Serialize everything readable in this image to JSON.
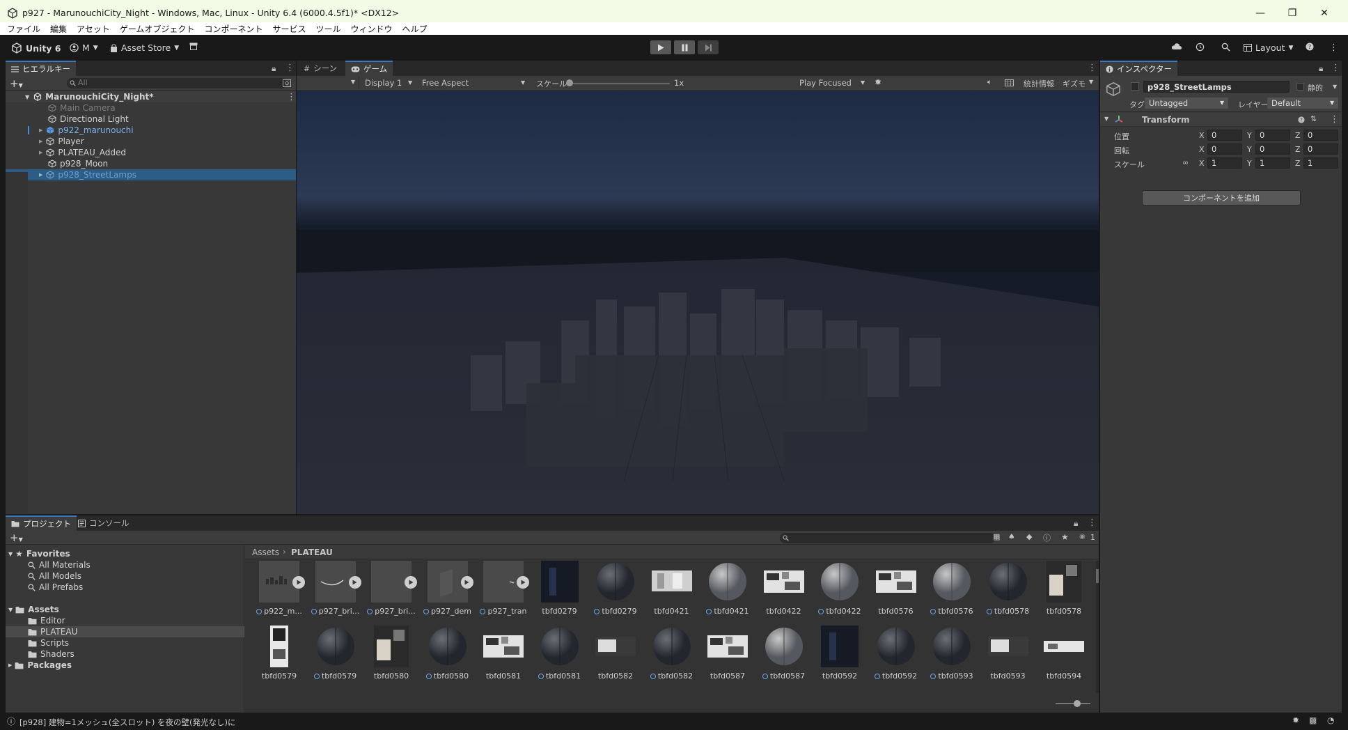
{
  "window": {
    "title": "p927 - MarunouchiCity_Night - Windows, Mac, Linux - Unity 6.4 (6000.4.5f1)* <DX12>"
  },
  "menu": [
    "ファイル",
    "編集",
    "アセット",
    "ゲームオブジェクト",
    "コンポーネント",
    "サービス",
    "ツール",
    "ウィンドウ",
    "ヘルプ"
  ],
  "toolbar": {
    "unity_label": "Unity 6",
    "account_label": "M",
    "asset_store_label": "Asset Store",
    "layout_label": "Layout"
  },
  "hierarchy": {
    "tab_label": "ヒエラルキー",
    "search_placeholder": "All",
    "scene_name": "MarunouchiCity_Night*",
    "items": [
      {
        "label": "Main Camera",
        "state": "disabled"
      },
      {
        "label": "Directional Light",
        "state": "normal"
      },
      {
        "label": "p922_marunouchi",
        "state": "prefab"
      },
      {
        "label": "Player",
        "state": "normal"
      },
      {
        "label": "PLATEAU_Added",
        "state": "normal"
      },
      {
        "label": "p928_Moon",
        "state": "normal"
      },
      {
        "label": "p928_StreetLamps",
        "state": "selected"
      }
    ]
  },
  "game_view": {
    "scene_tab": "シーン",
    "game_tab": "ゲーム",
    "display": "Display 1",
    "aspect": "Free Aspect",
    "scale_label": "スケール",
    "scale_value": "1x",
    "play_mode": "Play Focused",
    "stats_label": "統計情報",
    "gizmos_label": "ギズモ"
  },
  "inspector": {
    "tab_label": "インスペクター",
    "object_name": "p928_StreetLamps",
    "static_label": "静的",
    "tag_label": "タグ",
    "tag_value": "Untagged",
    "layer_label": "レイヤー",
    "layer_value": "Default",
    "component": "Transform",
    "rows": [
      {
        "label": "位置",
        "x": "0",
        "y": "0",
        "z": "0"
      },
      {
        "label": "回転",
        "x": "0",
        "y": "0",
        "z": "0"
      },
      {
        "label": "スケール",
        "x": "1",
        "y": "1",
        "z": "1"
      }
    ],
    "axis_x": "X",
    "axis_y": "Y",
    "axis_z": "Z",
    "add_component": "コンポーネントを追加"
  },
  "project": {
    "tab_label": "プロジェクト",
    "console_tab": "コンソール",
    "favorites_label": "Favorites",
    "favorites": [
      "All Materials",
      "All Models",
      "All Prefabs"
    ],
    "assets_label": "Assets",
    "folders": [
      "Editor",
      "PLATEAU",
      "Scripts",
      "Shaders"
    ],
    "packages_label": "Packages",
    "breadcrumb_root": "Assets",
    "breadcrumb_current": "PLATEAU",
    "visible_count": "1",
    "assets_row1": [
      {
        "name": "p922_m...",
        "kind": "model"
      },
      {
        "name": "p927_bri...",
        "kind": "model-curve"
      },
      {
        "name": "p927_bri...",
        "kind": "model-blank"
      },
      {
        "name": "p927_dem",
        "kind": "model-plane"
      },
      {
        "name": "p927_tran",
        "kind": "model-small"
      },
      {
        "name": "tbfd0279",
        "kind": "texture-dark"
      },
      {
        "name": "tbfd0279",
        "kind": "material"
      },
      {
        "name": "tbfd0421",
        "kind": "texture-light"
      },
      {
        "name": "tbfd0421",
        "kind": "material-light"
      },
      {
        "name": "tbfd0422",
        "kind": "texture-mix"
      },
      {
        "name": "tbfd0422",
        "kind": "material-light"
      },
      {
        "name": "tbfd0576",
        "kind": "texture-mix"
      },
      {
        "name": "tbfd0576",
        "kind": "material-light"
      },
      {
        "name": "tbfd0578",
        "kind": "material"
      },
      {
        "name": "tbfd0578",
        "kind": "texture-tall"
      }
    ],
    "assets_row2": [
      {
        "name": "tbfd0579",
        "kind": "texture-tall-narrow"
      },
      {
        "name": "tbfd0579",
        "kind": "material"
      },
      {
        "name": "tbfd0580",
        "kind": "texture-tall"
      },
      {
        "name": "tbfd0580",
        "kind": "material"
      },
      {
        "name": "tbfd0581",
        "kind": "texture-mix"
      },
      {
        "name": "tbfd0581",
        "kind": "material"
      },
      {
        "name": "tbfd0582",
        "kind": "texture-wide"
      },
      {
        "name": "tbfd0582",
        "kind": "material"
      },
      {
        "name": "tbfd0587",
        "kind": "texture-mix"
      },
      {
        "name": "tbfd0587",
        "kind": "material-light"
      },
      {
        "name": "tbfd0592",
        "kind": "texture-dark"
      },
      {
        "name": "tbfd0592",
        "kind": "material"
      },
      {
        "name": "tbfd0593",
        "kind": "material"
      },
      {
        "name": "tbfd0593",
        "kind": "texture-wide"
      },
      {
        "name": "tbfd0594",
        "kind": "texture-wide-light"
      }
    ]
  },
  "status_bar": {
    "message": "[p928] 建物=1メッシュ(全スロット) を夜の壁(発光なし)に"
  }
}
